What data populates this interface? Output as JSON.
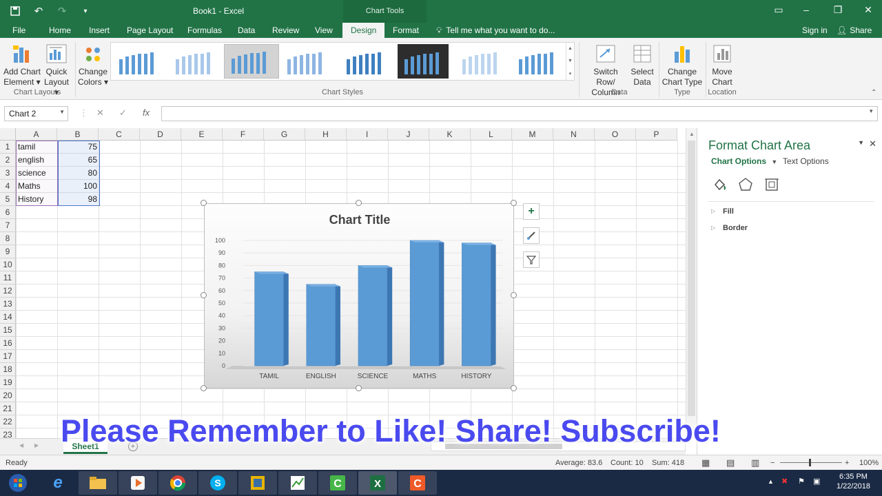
{
  "app": {
    "doc_title": "Book1 - Excel",
    "context_tools": "Chart Tools"
  },
  "tabs": [
    "File",
    "Home",
    "Insert",
    "Page Layout",
    "Formulas",
    "Data",
    "Review",
    "View",
    "Design",
    "Format"
  ],
  "tellme": "Tell me what you want to do...",
  "account": {
    "signin": "Sign in",
    "share": "Share"
  },
  "ribbon": {
    "add_chart_element": [
      "Add Chart",
      "Element ▾"
    ],
    "quick_layout": [
      "Quick",
      "Layout ▾"
    ],
    "change_colors": [
      "Change",
      "Colors ▾"
    ],
    "switch_row_col": [
      "Switch Row/",
      "Column"
    ],
    "select_data": [
      "Select",
      "Data"
    ],
    "change_chart_type": [
      "Change",
      "Chart Type"
    ],
    "move_chart": [
      "Move",
      "Chart"
    ],
    "groups": {
      "chart_layouts": "Chart Layouts",
      "chart_styles": "Chart Styles",
      "data": "Data",
      "type": "Type",
      "location": "Location"
    }
  },
  "namebox": "Chart 2",
  "formula_fx": "fx",
  "columns": [
    "A",
    "B",
    "C",
    "D",
    "E",
    "F",
    "G",
    "H",
    "I",
    "J",
    "K",
    "L",
    "M",
    "N",
    "O",
    "P"
  ],
  "rows": [
    "1",
    "2",
    "3",
    "4",
    "5",
    "6",
    "7",
    "8",
    "9",
    "10",
    "11",
    "12",
    "13",
    "14",
    "15",
    "16",
    "17",
    "18",
    "19",
    "20",
    "21",
    "22",
    "23"
  ],
  "cells": [
    {
      "label": "tamil",
      "value": "75"
    },
    {
      "label": "english",
      "value": "65"
    },
    {
      "label": "science",
      "value": "80"
    },
    {
      "label": "Maths",
      "value": "100"
    },
    {
      "label": "History",
      "value": "98"
    }
  ],
  "chart_data": {
    "type": "bar",
    "title": "Chart Title",
    "categories": [
      "TAMIL",
      "ENGLISH",
      "SCIENCE",
      "MATHS",
      "HISTORY"
    ],
    "values": [
      75,
      65,
      80,
      100,
      98
    ],
    "ylim": [
      0,
      100
    ],
    "yticks": [
      "0",
      "10",
      "20",
      "30",
      "40",
      "50",
      "60",
      "70",
      "80",
      "90",
      "100"
    ],
    "grid": true,
    "legend": "none",
    "bar_color": "#5b9bd5"
  },
  "pane": {
    "title": "Format Chart Area",
    "tab_chart_options": "Chart Options",
    "tab_text_options": "Text Options",
    "items": [
      "Fill",
      "Border"
    ]
  },
  "banner": "Please Remember to Like! Share! Subscribe!",
  "sheet": {
    "name": "Sheet1"
  },
  "status": {
    "ready": "Ready",
    "average": "Average: 83.6",
    "count": "Count: 10",
    "sum": "Sum: 418",
    "zoom": "100%"
  },
  "clock": {
    "time": "6:35 PM",
    "date": "1/22/2018"
  },
  "colors": {
    "excel_green": "#217346",
    "accent_blue": "#4a4af0"
  }
}
